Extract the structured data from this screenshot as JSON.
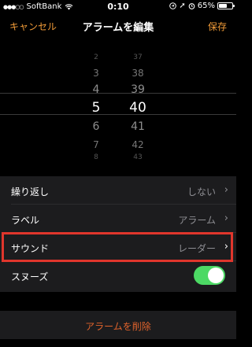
{
  "status_bar": {
    "carrier": "SoftBank",
    "time": "0:10",
    "battery_text": "65%",
    "battery_level": 0.65
  },
  "nav": {
    "cancel_label": "キャンセル",
    "title": "アラームを編集",
    "save_label": "保存"
  },
  "picker": {
    "hours": [
      "2",
      "3",
      "4",
      "5",
      "6",
      "7",
      "8"
    ],
    "minutes": [
      "37",
      "38",
      "39",
      "40",
      "41",
      "42",
      "43"
    ],
    "selected_hour": "5",
    "selected_minute": "40"
  },
  "settings": {
    "repeat": {
      "label": "繰り返し",
      "value": "しない"
    },
    "label_row": {
      "label": "ラベル",
      "value": "アラーム"
    },
    "sound": {
      "label": "サウンド",
      "value": "レーダー"
    },
    "snooze": {
      "label": "スヌーズ",
      "enabled": true
    }
  },
  "delete_label": "アラームを削除",
  "colors": {
    "accent": "#f29c38",
    "highlight": "#e0362c",
    "toggle_on": "#4cd964",
    "delete": "#e0632c"
  }
}
